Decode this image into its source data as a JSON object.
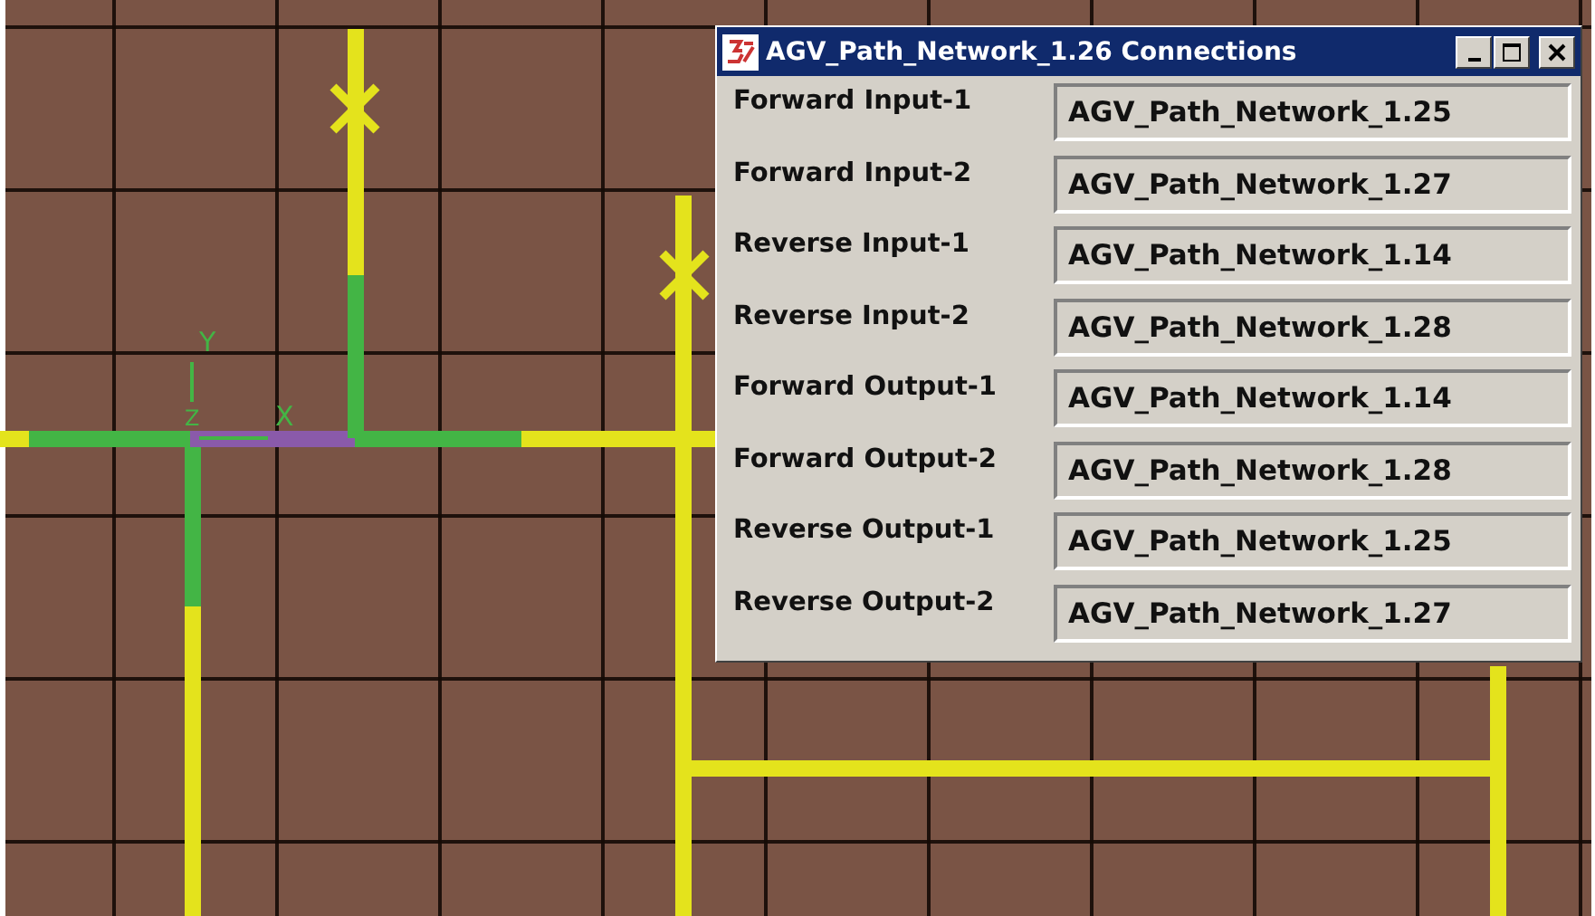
{
  "triad": {
    "x": "X",
    "y": "Y",
    "z": "Z"
  },
  "window": {
    "title": "AGV_Path_Network_1.26 Connections"
  },
  "connections": [
    {
      "label": "Forward Input-1",
      "value": "AGV_Path_Network_1.25"
    },
    {
      "label": "Forward Input-2",
      "value": "AGV_Path_Network_1.27"
    },
    {
      "label": "Reverse Input-1",
      "value": "AGV_Path_Network_1.14"
    },
    {
      "label": "Reverse Input-2",
      "value": "AGV_Path_Network_1.28"
    },
    {
      "label": "Forward Output-1",
      "value": "AGV_Path_Network_1.14"
    },
    {
      "label": "Forward Output-2",
      "value": "AGV_Path_Network_1.28"
    },
    {
      "label": "Reverse Output-1",
      "value": "AGV_Path_Network_1.25"
    },
    {
      "label": "Reverse Output-2",
      "value": "AGV_Path_Network_1.27"
    }
  ]
}
